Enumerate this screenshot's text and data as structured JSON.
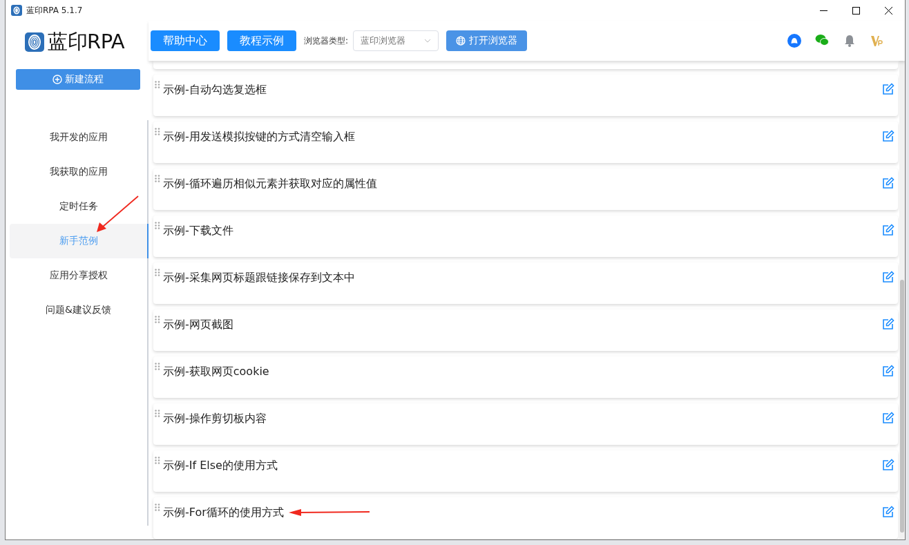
{
  "window": {
    "title": "蓝印RPA 5.1.7"
  },
  "sidebar": {
    "logo_text": "蓝印RPA",
    "new_button": "新建流程",
    "items": [
      {
        "label": "我开发的应用",
        "selected": false
      },
      {
        "label": "我获取的应用",
        "selected": false
      },
      {
        "label": "定时任务",
        "selected": false
      },
      {
        "label": "新手范例",
        "selected": true
      },
      {
        "label": "应用分享授权",
        "selected": false
      },
      {
        "label": "问题&建议反馈",
        "selected": false
      }
    ]
  },
  "toolbar": {
    "buttons": [
      {
        "label": "帮助中心"
      },
      {
        "label": "教程示例"
      }
    ],
    "browser_label": "浏览器类型:",
    "browser_select": {
      "value": "蓝印浏览器"
    },
    "open_browser": "打开浏览器"
  },
  "examples": [
    {
      "title": "示例-自动勾选复选框"
    },
    {
      "title": "示例-用发送模拟按键的方式清空输入框"
    },
    {
      "title": "示例-循环遍历相似元素并获取对应的属性值"
    },
    {
      "title": "示例-下载文件"
    },
    {
      "title": "示例-采集网页标题跟链接保存到文本中"
    },
    {
      "title": "示例-网页截图"
    },
    {
      "title": "示例-获取网页cookie"
    },
    {
      "title": "示例-操作剪切板内容"
    },
    {
      "title": "示例-If Else的使用方式"
    },
    {
      "title": "示例-For循环的使用方式"
    }
  ]
}
